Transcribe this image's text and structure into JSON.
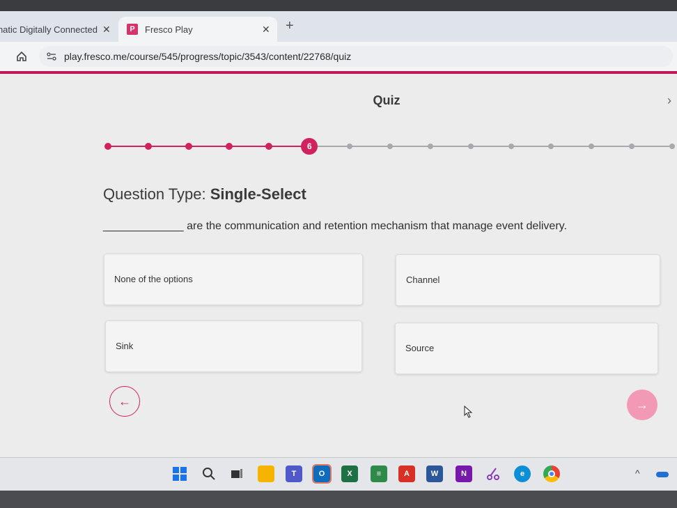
{
  "browser": {
    "tabs": [
      {
        "title": "Pragmatic Digitally Connected",
        "close": "✕"
      },
      {
        "title": "Fresco Play",
        "favicon": "P",
        "close": "✕"
      }
    ],
    "new_tab": "+",
    "url": "play.fresco.me/course/545/progress/topic/3543/content/22768/quiz"
  },
  "quiz": {
    "title": "Quiz",
    "current_question": "6",
    "total_steps": 15,
    "completed_steps": 5,
    "question_type_label": "Question Type: ",
    "question_type_value": "Single-Select",
    "question_text": "_____________ are the communication and retention mechanism that manage event delivery.",
    "options": [
      "None of the options",
      "Channel",
      "Sink",
      "Source"
    ],
    "prev_arrow": "←",
    "next_arrow": "→"
  },
  "colors": {
    "accent": "#d0225e",
    "accent_light": "#f29ab5",
    "inactive_step": "#a7a9ad"
  },
  "taskbar": {
    "icons": [
      "windows-start-icon",
      "search-icon",
      "task-view-icon",
      "file-explorer-icon",
      "teams-icon",
      "outlook-icon",
      "excel-icon",
      "notepad-icon",
      "acrobat-icon",
      "word-icon",
      "onenote-icon",
      "snipping-tool-icon",
      "edge-icon",
      "chrome-icon"
    ],
    "overflow": "^"
  }
}
